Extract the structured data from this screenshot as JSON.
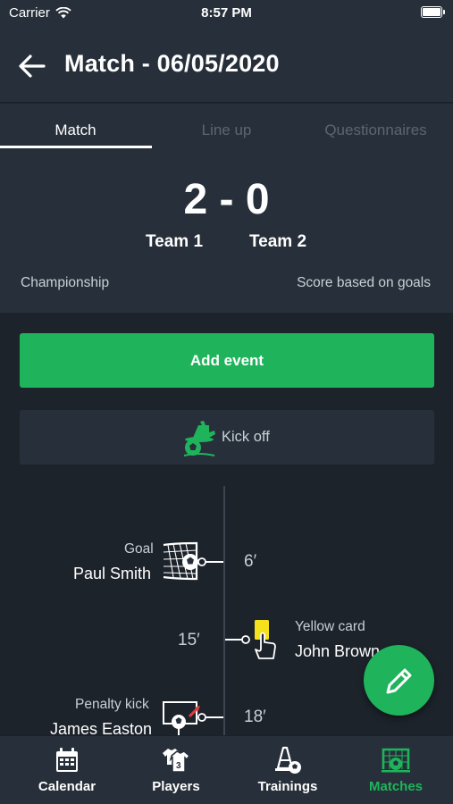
{
  "status_bar": {
    "carrier": "Carrier",
    "time": "8:57 PM"
  },
  "header": {
    "title": "Match - 06/05/2020"
  },
  "tabs": [
    {
      "label": "Match",
      "active": true
    },
    {
      "label": "Line up",
      "active": false
    },
    {
      "label": "Questionnaires",
      "active": false
    }
  ],
  "match": {
    "score": "2 - 0",
    "team1": "Team 1",
    "team2": "Team 2",
    "competition": "Championship",
    "score_basis": "Score based on goals"
  },
  "actions": {
    "add_event_label": "Add event"
  },
  "kickoff": {
    "label": "Kick off"
  },
  "timeline": [
    {
      "type": "Goal",
      "player": "Paul Smith",
      "minute": "6′",
      "side": "left",
      "icon": "goal-net-icon"
    },
    {
      "type": "Yellow card",
      "player": "John Brown",
      "minute": "15′",
      "side": "right",
      "icon": "yellow-card-icon"
    },
    {
      "type": "Penalty kick",
      "player": "James Easton",
      "minute": "18′",
      "side": "left",
      "icon": "penalty-kick-icon"
    }
  ],
  "bottom_nav": [
    {
      "label": "Calendar",
      "icon": "calendar-icon",
      "active": false
    },
    {
      "label": "Players",
      "icon": "players-icon",
      "active": false
    },
    {
      "label": "Trainings",
      "icon": "trainings-icon",
      "active": false
    },
    {
      "label": "Matches",
      "icon": "matches-icon",
      "active": true
    }
  ],
  "colors": {
    "background": "#1d232b",
    "panel": "#27303a",
    "accent": "#1fb45c",
    "yellow_card": "#f5e11c",
    "inactive_tab": "#5c6672"
  }
}
